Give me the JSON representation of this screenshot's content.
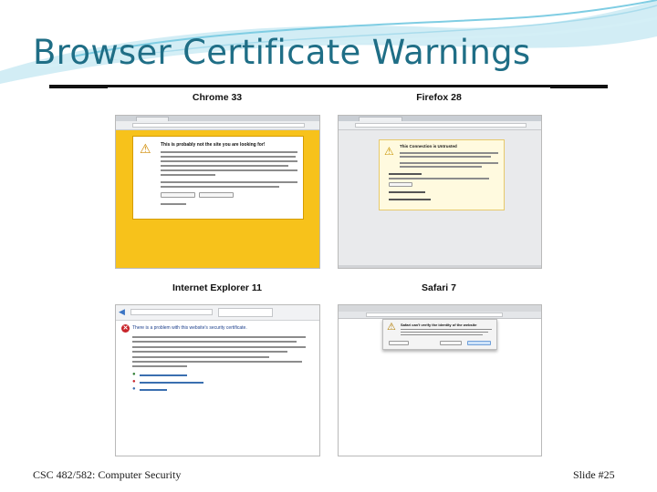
{
  "slide": {
    "title": "Browser Certificate Warnings",
    "footer_course": "CSC 482/582: Computer Security",
    "footer_slide": "Slide #25"
  },
  "screenshots": [
    {
      "label": "Chrome 33",
      "browser": "chrome",
      "headline": "This is probably not the site you are looking for!",
      "warning_bg": "#f7c21b"
    },
    {
      "label": "Firefox 28",
      "browser": "firefox",
      "headline": "This Connection is Untrusted",
      "warning_bg": "#fffadf"
    },
    {
      "label": "Internet Explorer 11",
      "browser": "ie",
      "headline": "There is a problem with this website's security certificate."
    },
    {
      "label": "Safari 7",
      "browser": "safari",
      "headline": "Safari can't verify the identity of the website"
    }
  ],
  "colors": {
    "title": "#1f6e86",
    "chrome_warning": "#f7c21b",
    "firefox_panel_border": "#e7c96c",
    "ie_error_icon": "#c8242a"
  },
  "icons": [
    "warning-icon",
    "error-icon",
    "lock-icon"
  ]
}
